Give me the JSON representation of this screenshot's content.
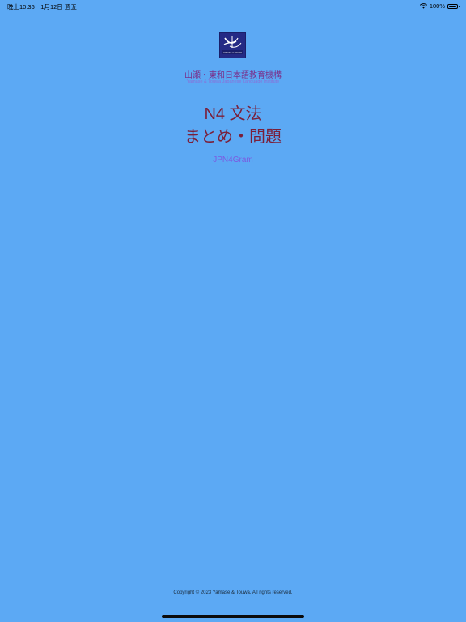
{
  "status_bar": {
    "time_date": "晚上10:36　1月12日 週五",
    "battery_percent": "100%",
    "battery_level": 1.0
  },
  "header": {
    "logo_text": "YAMASE & TOUWA",
    "org_name_ja": "山瀬・東和日本語教育機構",
    "org_name_en": "Yamase & Touwa Japanese Language Institute"
  },
  "main": {
    "title_line1": "N4 文法",
    "title_line2": "まとめ・問題",
    "app_code": "JPN4Gram"
  },
  "footer": {
    "copyright": "Copyright © 2023 Yamase & Touwa. All rights reserved."
  },
  "colors": {
    "background": "#5ca9f4",
    "title": "#7a1f3a",
    "org_name": "#7a2f8a",
    "app_code": "#7b5be0"
  },
  "icons": [
    "wifi-icon",
    "battery-icon",
    "institute-logo"
  ]
}
